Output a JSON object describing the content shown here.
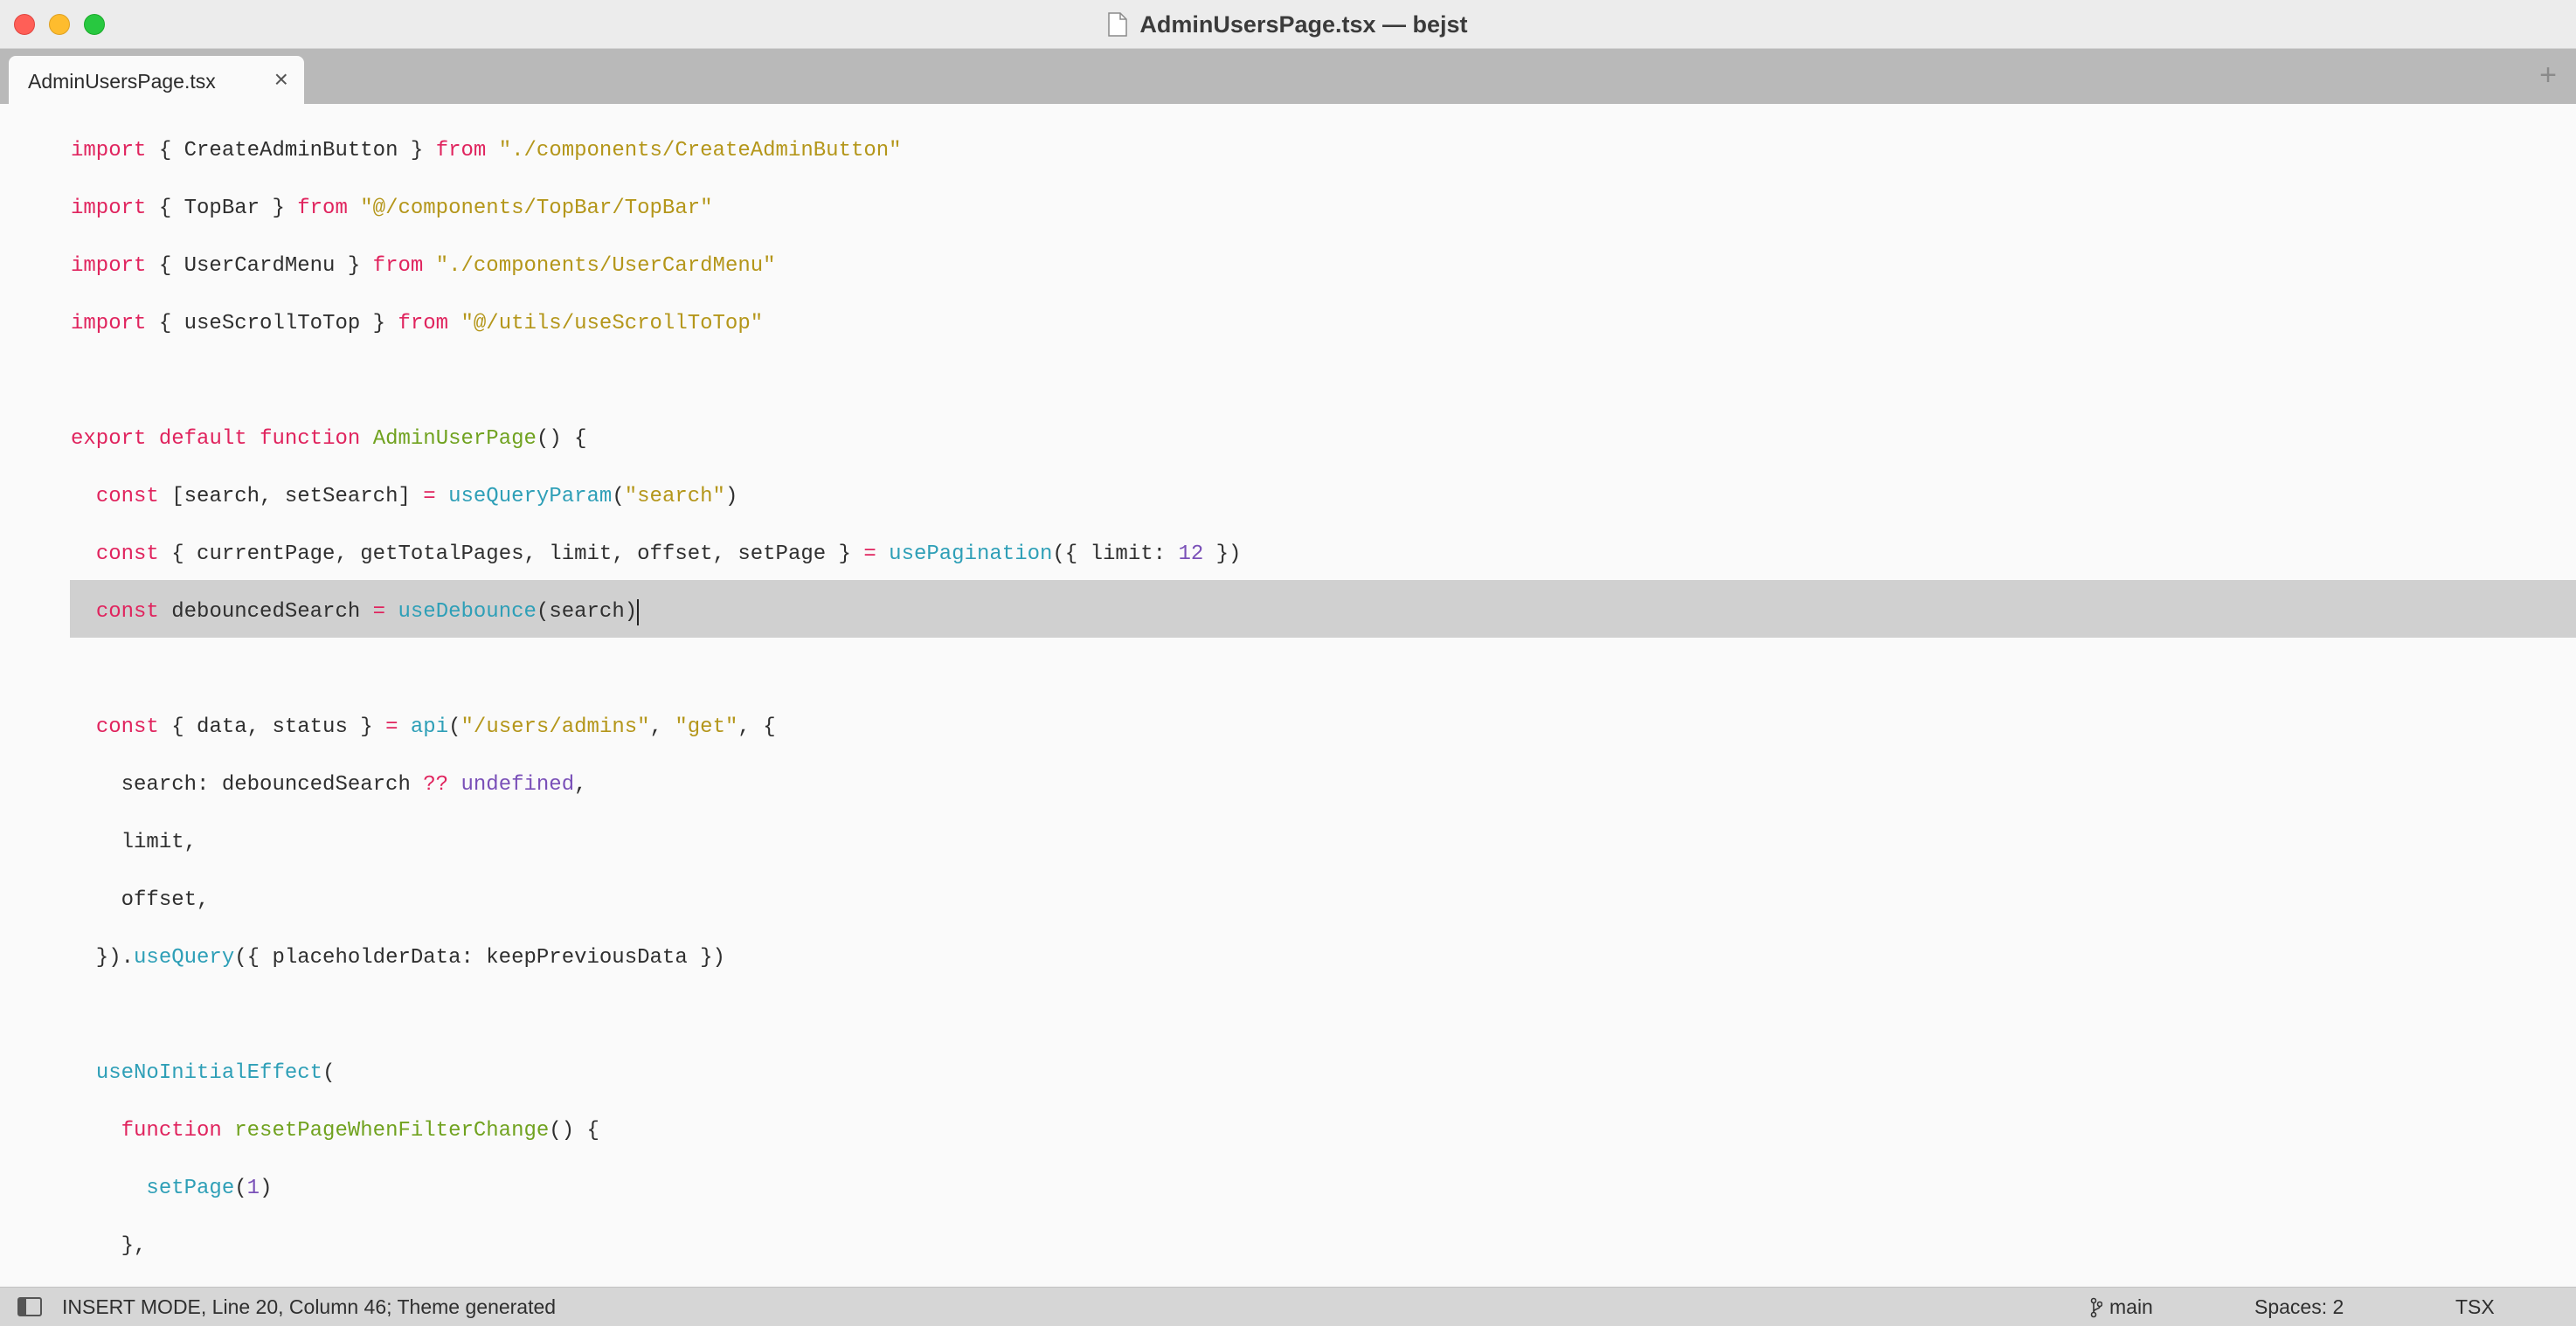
{
  "window": {
    "title": "AdminUsersPage.tsx — bejst"
  },
  "tabs": [
    {
      "label": "AdminUsersPage.tsx",
      "close": "×"
    }
  ],
  "tab_add": "+",
  "code": {
    "lines": [
      [
        {
          "t": "import",
          "c": "k"
        },
        {
          "t": " { CreateAdminButton } "
        },
        {
          "t": "from",
          "c": "k"
        },
        {
          "t": " "
        },
        {
          "t": "\"./components/CreateAdminButton\"",
          "c": "s"
        }
      ],
      [
        {
          "t": "import",
          "c": "k"
        },
        {
          "t": " { TopBar } "
        },
        {
          "t": "from",
          "c": "k"
        },
        {
          "t": " "
        },
        {
          "t": "\"@/components/TopBar/TopBar\"",
          "c": "s"
        }
      ],
      [
        {
          "t": "import",
          "c": "k"
        },
        {
          "t": " { UserCardMenu } "
        },
        {
          "t": "from",
          "c": "k"
        },
        {
          "t": " "
        },
        {
          "t": "\"./components/UserCardMenu\"",
          "c": "s"
        }
      ],
      [
        {
          "t": "import",
          "c": "k"
        },
        {
          "t": " { useScrollToTop } "
        },
        {
          "t": "from",
          "c": "k"
        },
        {
          "t": " "
        },
        {
          "t": "\"@/utils/useScrollToTop\"",
          "c": "s"
        }
      ],
      [],
      [
        {
          "t": "export",
          "c": "k"
        },
        {
          "t": " "
        },
        {
          "t": "default",
          "c": "k"
        },
        {
          "t": " "
        },
        {
          "t": "function",
          "c": "k"
        },
        {
          "t": " "
        },
        {
          "t": "AdminUserPage",
          "c": "f"
        },
        {
          "t": "() {"
        }
      ],
      [
        {
          "t": "  "
        },
        {
          "t": "const",
          "c": "k"
        },
        {
          "t": " [search, setSearch] "
        },
        {
          "t": "=",
          "c": "k"
        },
        {
          "t": " "
        },
        {
          "t": "useQueryParam",
          "c": "c"
        },
        {
          "t": "("
        },
        {
          "t": "\"search\"",
          "c": "s"
        },
        {
          "t": ")"
        }
      ],
      [
        {
          "t": "  "
        },
        {
          "t": "const",
          "c": "k"
        },
        {
          "t": " { currentPage, getTotalPages, limit, offset, setPage } "
        },
        {
          "t": "=",
          "c": "k"
        },
        {
          "t": " "
        },
        {
          "t": "usePagination",
          "c": "c"
        },
        {
          "t": "({ limit: "
        },
        {
          "t": "12",
          "c": "n"
        },
        {
          "t": " })"
        }
      ],
      [
        {
          "t": "  "
        },
        {
          "t": "const",
          "c": "k"
        },
        {
          "t": " debouncedSearch "
        },
        {
          "t": "=",
          "c": "k"
        },
        {
          "t": " "
        },
        {
          "t": "useDebounce",
          "c": "c"
        },
        {
          "t": "(search)"
        }
      ],
      [],
      [
        {
          "t": "  "
        },
        {
          "t": "const",
          "c": "k"
        },
        {
          "t": " { data, status } "
        },
        {
          "t": "=",
          "c": "k"
        },
        {
          "t": " "
        },
        {
          "t": "api",
          "c": "c"
        },
        {
          "t": "("
        },
        {
          "t": "\"/users/admins\"",
          "c": "s"
        },
        {
          "t": ", "
        },
        {
          "t": "\"get\"",
          "c": "s"
        },
        {
          "t": ", {"
        }
      ],
      [
        {
          "t": "    search: debouncedSearch "
        },
        {
          "t": "??",
          "c": "k"
        },
        {
          "t": " "
        },
        {
          "t": "undefined",
          "c": "n"
        },
        {
          "t": ","
        }
      ],
      [
        {
          "t": "    limit,"
        }
      ],
      [
        {
          "t": "    offset,"
        }
      ],
      [
        {
          "t": "  })."
        },
        {
          "t": "useQuery",
          "c": "c"
        },
        {
          "t": "({ placeholderData: keepPreviousData })"
        }
      ],
      [],
      [
        {
          "t": "  "
        },
        {
          "t": "useNoInitialEffect",
          "c": "c"
        },
        {
          "t": "("
        }
      ],
      [
        {
          "t": "    "
        },
        {
          "t": "function",
          "c": "k"
        },
        {
          "t": " "
        },
        {
          "t": "resetPageWhenFilterChange",
          "c": "f"
        },
        {
          "t": "() {"
        }
      ],
      [
        {
          "t": "      "
        },
        {
          "t": "setPage",
          "c": "c"
        },
        {
          "t": "("
        },
        {
          "t": "1",
          "c": "n"
        },
        {
          "t": ")"
        }
      ],
      [
        {
          "t": "    },"
        }
      ]
    ],
    "highlight_line": 8
  },
  "status": {
    "left": "INSERT MODE, Line 20, Column 46; Theme generated",
    "branch": "main",
    "spaces": "Spaces: 2",
    "syntax": "TSX"
  }
}
